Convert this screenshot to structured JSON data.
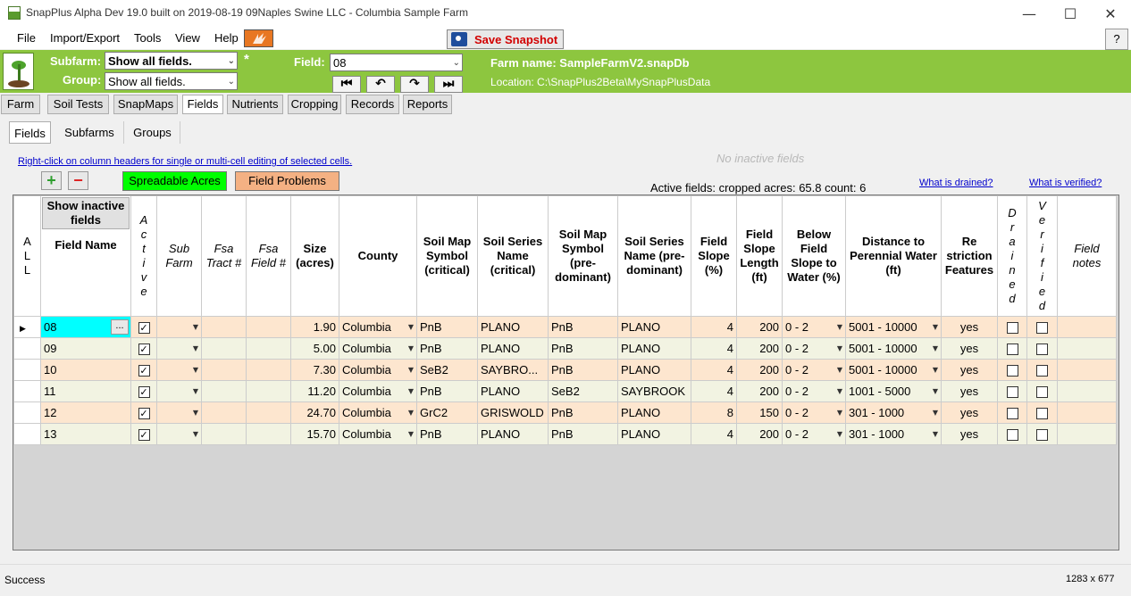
{
  "window": {
    "title": "SnapPlus Alpha Dev 19.0 built on 2019-08-19 09Naples Swine LLC - Columbia Sample Farm",
    "minimize": "—",
    "maximize": "☐",
    "close": "✕"
  },
  "menu": {
    "file": "File",
    "import_export": "Import/Export",
    "tools": "Tools",
    "view": "View",
    "help": "Help",
    "save_snapshot": "Save Snapshot",
    "question": "?"
  },
  "header": {
    "subfarm_label": "Subfarm:",
    "subfarm_value": "Show all fields.",
    "group_label": "Group:",
    "group_value": "Show all fields.",
    "asterisk": "*",
    "field_label": "Field:",
    "field_value": "08",
    "nav": {
      "first": "⏮",
      "prev": "↶",
      "next": "↷",
      "last": "⏭"
    },
    "farm_name": "Farm name: SampleFarmV2.snapDb",
    "location": "Location: C:\\SnapPlus2Beta\\MySnapPlusData"
  },
  "main_tabs": [
    "Farm",
    "Soil Tests",
    "SnapMaps",
    "Fields",
    "Nutrients",
    "Cropping",
    "Records",
    "Reports"
  ],
  "sub_tabs": [
    "Fields",
    "Subfarms",
    "Groups"
  ],
  "toolbar": {
    "hint": "Right-click on column headers for single or multi-cell editing of selected cells.",
    "no_inactive": "No inactive fields",
    "add": "+",
    "remove": "−",
    "spreadable": "Spreadable Acres",
    "problems": "Field Problems",
    "summary": "Active fields: cropped acres: 65.8  count: 6",
    "drained_link": "What is drained?",
    "verified_link": "What is verified?"
  },
  "columns": {
    "all": "A\nL\nL",
    "show_inactive": "Show inactive fields",
    "field_name": "Field Name",
    "active": "A\nc\nt\ni\nv\ne",
    "sub_farm": "Sub Farm",
    "fsa_tract": "Fsa Tract #",
    "fsa_field": "Fsa Field #",
    "size": "Size (acres)",
    "county": "County",
    "soil_map_crit": "Soil Map Symbol (critical)",
    "soil_series_crit": "Soil Series Name (critical)",
    "soil_map_pre": "Soil Map Symbol (pre-dominant)",
    "soil_series_pre": "Soil Series Name (pre-dominant)",
    "slope": "Field Slope (%)",
    "slope_len": "Field Slope Length (ft)",
    "below_slope": "Below Field Slope to Water (%)",
    "distance": "Distance to Perennial Water (ft)",
    "restriction": "Re striction Features",
    "drained": "D\nr\na\ni\nn\ne\nd",
    "verified": "V\ne\nr\ni\nf\ni\ne\nd",
    "notes": "Field notes"
  },
  "rows": [
    {
      "name": "08",
      "active": true,
      "size": "1.90",
      "county": "Columbia",
      "smc": "PnB",
      "ssc": "PLANO",
      "smp": "PnB",
      "ssp": "PLANO",
      "slope": "4",
      "len": "200",
      "below": "0 - 2",
      "dist": "5001 - 10000",
      "restr": "yes"
    },
    {
      "name": "09",
      "active": true,
      "size": "5.00",
      "county": "Columbia",
      "smc": "PnB",
      "ssc": "PLANO",
      "smp": "PnB",
      "ssp": "PLANO",
      "slope": "4",
      "len": "200",
      "below": "0 - 2",
      "dist": "5001 - 10000",
      "restr": "yes"
    },
    {
      "name": "10",
      "active": true,
      "size": "7.30",
      "county": "Columbia",
      "smc": "SeB2",
      "ssc": "SAYBRO...",
      "smp": "PnB",
      "ssp": "PLANO",
      "slope": "4",
      "len": "200",
      "below": "0 - 2",
      "dist": "5001 - 10000",
      "restr": "yes"
    },
    {
      "name": "11",
      "active": true,
      "size": "11.20",
      "county": "Columbia",
      "smc": "PnB",
      "ssc": "PLANO",
      "smp": "SeB2",
      "ssp": "SAYBROOK",
      "slope": "4",
      "len": "200",
      "below": "0 - 2",
      "dist": "1001 - 5000",
      "restr": "yes"
    },
    {
      "name": "12",
      "active": true,
      "size": "24.70",
      "county": "Columbia",
      "smc": "GrC2",
      "ssc": "GRISWOLD",
      "smp": "PnB",
      "ssp": "PLANO",
      "slope": "8",
      "len": "150",
      "below": "0 - 2",
      "dist": "301 - 1000",
      "restr": "yes"
    },
    {
      "name": "13",
      "active": true,
      "size": "15.70",
      "county": "Columbia",
      "smc": "PnB",
      "ssc": "PLANO",
      "smp": "PnB",
      "ssp": "PLANO",
      "slope": "4",
      "len": "200",
      "below": "0 - 2",
      "dist": "301 - 1000",
      "restr": "yes"
    }
  ],
  "status": {
    "left": "Success",
    "right": "1283 x 677"
  },
  "colors": {
    "green_bar": "#8dc63f",
    "spreadable": "#00ff00",
    "problems": "#f4a460",
    "row_odd": "#fde6cf",
    "row_even": "#f2f3e2",
    "selected_cell": "#00ffff"
  }
}
